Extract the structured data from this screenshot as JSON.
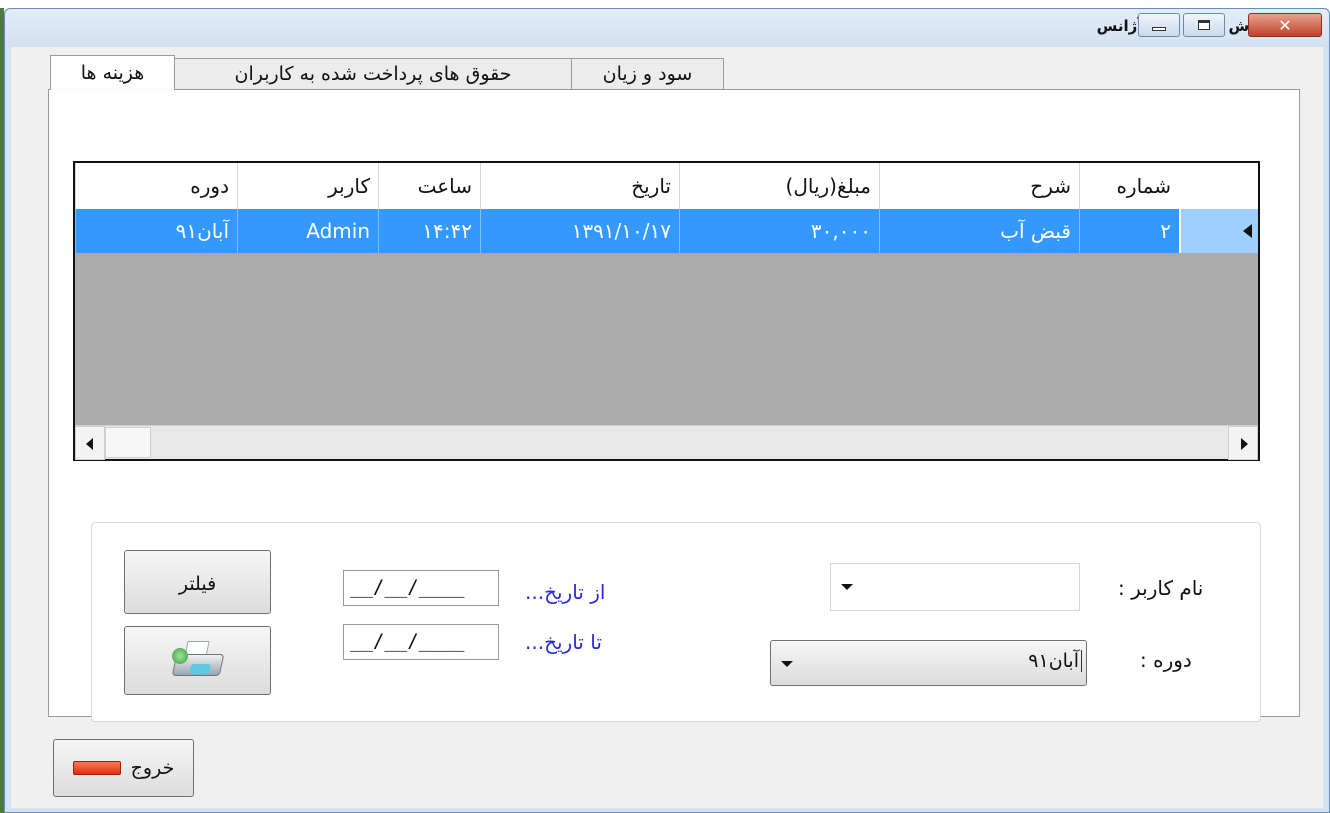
{
  "window": {
    "title": "گزارش هزینه های آژانس",
    "close_glyph": "✕"
  },
  "tabs": [
    {
      "label": "هزینه ها",
      "selected": true
    },
    {
      "label": "حقوق های پرداخت شده به کاربران",
      "selected": false
    },
    {
      "label": "سود و زیان",
      "selected": false
    }
  ],
  "grid": {
    "columns": [
      "شماره",
      "شرح",
      "مبلغ(ریال)",
      "تاریخ",
      "ساعت",
      "کاربر",
      "دوره"
    ],
    "rows": [
      {
        "number": "۲",
        "description": "قبض آب",
        "amount": "۳۰,۰۰۰",
        "date": "۱۳۹۱/۱۰/۱۷",
        "time": "۱۴:۴۲",
        "user": "Admin",
        "period": "آبان۹۱",
        "selected": true
      }
    ],
    "selection_color": "#3399ff"
  },
  "filter": {
    "user_label": "نام کاربر :",
    "user_value": "",
    "period_label": "دوره :",
    "period_value": "آبان۹۱",
    "from_date_label": "از تاریخ...",
    "to_date_label": "تا تاریخ...",
    "from_date_value": "__/__/____",
    "to_date_value": "__/__/____",
    "filter_button_label": "فیلتر"
  },
  "footer": {
    "exit_label": "خروج"
  },
  "icons": {
    "print": "printer-icon",
    "exit": "exit-icon",
    "app": "app-icon"
  }
}
